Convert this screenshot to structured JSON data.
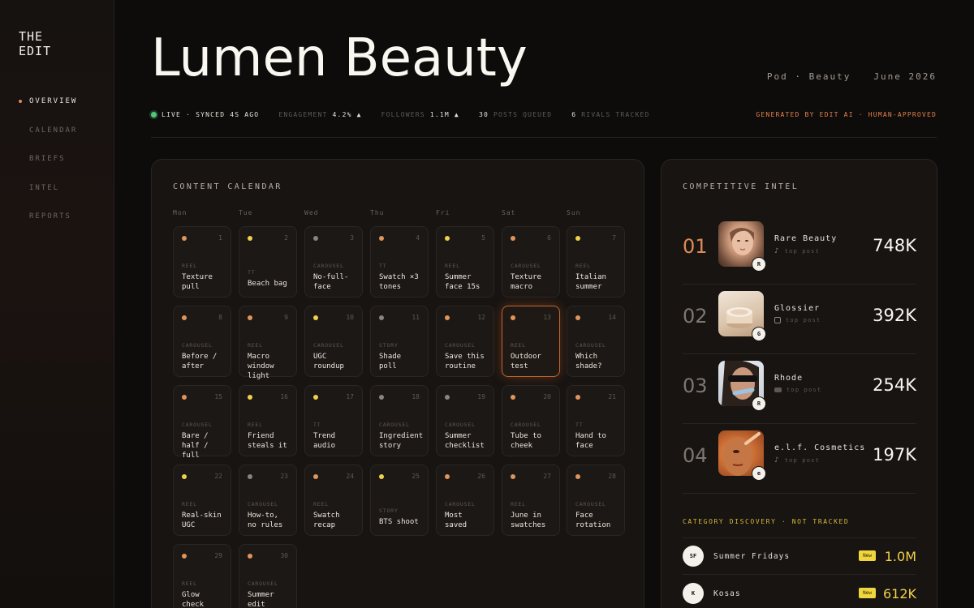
{
  "sidebar": {
    "logo": "THE\nEDIT",
    "items": [
      {
        "label": "OVERVIEW",
        "active": true
      },
      {
        "label": "CALENDAR",
        "active": false
      },
      {
        "label": "BRIEFS",
        "active": false
      },
      {
        "label": "INTEL",
        "active": false
      },
      {
        "label": "REPORTS",
        "active": false
      }
    ]
  },
  "header": {
    "title": "Lumen Beauty",
    "pod": "Pod · Beauty",
    "date": "June 2026",
    "status": {
      "live": "LIVE · SYNCED 4S AGO",
      "engagement_label": "ENGAGEMENT",
      "engagement_value": "4.2% ▲",
      "followers_label": "FOLLOWERS",
      "followers_value": "1.1M ▲",
      "posts_count": "30",
      "posts_label": "POSTS QUEUED",
      "rivals_count": "6",
      "rivals_label": "RIVALS TRACKED",
      "generated": "GENERATED BY EDIT AI · HUMAN-APPROVED"
    }
  },
  "calendar": {
    "title": "CONTENT CALENDAR",
    "days": [
      "Mon",
      "Tue",
      "Wed",
      "Thu",
      "Fri",
      "Sat",
      "Sun"
    ],
    "selected_day": 13,
    "cells": [
      {
        "num": "1",
        "kind": "REEL",
        "label": "Texture pull",
        "color": "#e0955a"
      },
      {
        "num": "2",
        "kind": "TT",
        "label": "Beach bag",
        "color": "#f0d24a"
      },
      {
        "num": "3",
        "kind": "CAROUSEL",
        "label": "No-full-face",
        "color": "#8b847e"
      },
      {
        "num": "4",
        "kind": "TT",
        "label": "Swatch ×3 tones",
        "color": "#e0955a"
      },
      {
        "num": "5",
        "kind": "REEL",
        "label": "Summer face 15s",
        "color": "#f0d24a"
      },
      {
        "num": "6",
        "kind": "CAROUSEL",
        "label": "Texture macro",
        "color": "#e0955a"
      },
      {
        "num": "7",
        "kind": "REEL",
        "label": "Italian summer",
        "color": "#f0d24a"
      },
      {
        "num": "8",
        "kind": "CAROUSEL",
        "label": "Before / after",
        "color": "#e0955a"
      },
      {
        "num": "9",
        "kind": "REEL",
        "label": "Macro window light",
        "color": "#e0955a"
      },
      {
        "num": "10",
        "kind": "CAROUSEL",
        "label": "UGC roundup",
        "color": "#f0d24a"
      },
      {
        "num": "11",
        "kind": "STORY",
        "label": "Shade poll",
        "color": "#8b847e"
      },
      {
        "num": "12",
        "kind": "CAROUSEL",
        "label": "Save this routine",
        "color": "#e0955a"
      },
      {
        "num": "13",
        "kind": "REEL",
        "label": "Outdoor test",
        "color": "#e0955a"
      },
      {
        "num": "14",
        "kind": "CAROUSEL",
        "label": "Which shade?",
        "color": "#e0955a"
      },
      {
        "num": "15",
        "kind": "CAROUSEL",
        "label": "Bare / half / full",
        "color": "#e0955a"
      },
      {
        "num": "16",
        "kind": "REEL",
        "label": "Friend steals it",
        "color": "#f0d24a"
      },
      {
        "num": "17",
        "kind": "TT",
        "label": "Trend audio",
        "color": "#f0d24a"
      },
      {
        "num": "18",
        "kind": "CAROUSEL",
        "label": "Ingredient story",
        "color": "#8b847e"
      },
      {
        "num": "19",
        "kind": "CAROUSEL",
        "label": "Summer checklist",
        "color": "#8b847e"
      },
      {
        "num": "20",
        "kind": "CAROUSEL",
        "label": "Tube to cheek",
        "color": "#e0955a"
      },
      {
        "num": "21",
        "kind": "TT",
        "label": "Hand to face",
        "color": "#e0955a"
      },
      {
        "num": "22",
        "kind": "REEL",
        "label": "Real-skin UGC",
        "color": "#f0d24a"
      },
      {
        "num": "23",
        "kind": "CAROUSEL",
        "label": "How-to, no rules",
        "color": "#8b847e"
      },
      {
        "num": "24",
        "kind": "REEL",
        "label": "Swatch recap",
        "color": "#e0955a"
      },
      {
        "num": "25",
        "kind": "STORY",
        "label": "BTS shoot",
        "color": "#f0d24a"
      },
      {
        "num": "26",
        "kind": "CAROUSEL",
        "label": "Most saved",
        "color": "#e0955a"
      },
      {
        "num": "27",
        "kind": "REEL",
        "label": "June in swatches",
        "color": "#e0955a"
      },
      {
        "num": "28",
        "kind": "CAROUSEL",
        "label": "Face rotation",
        "color": "#e0955a"
      },
      {
        "num": "29",
        "kind": "REEL",
        "label": "Glow check",
        "color": "#e0955a"
      },
      {
        "num": "30",
        "kind": "CAROUSEL",
        "label": "Summer edit",
        "color": "#e0955a"
      }
    ]
  },
  "intel": {
    "title": "COMPETITIVE INTEL",
    "rivals": [
      {
        "rank": "01",
        "name": "Rare Beauty",
        "badge": "R",
        "platform_icon": "tiktok-icon",
        "sub": "top post",
        "count": "748K"
      },
      {
        "rank": "02",
        "name": "Glossier",
        "badge": "G",
        "platform_icon": "instagram-icon",
        "sub": "top post",
        "count": "392K"
      },
      {
        "rank": "03",
        "name": "Rhode",
        "badge": "R",
        "platform_icon": "youtube-icon",
        "sub": "top post",
        "count": "254K"
      },
      {
        "rank": "04",
        "name": "e.l.f. Cosmetics",
        "badge": "e",
        "platform_icon": "tiktok-icon",
        "sub": "top post",
        "count": "197K"
      }
    ],
    "discovery_title": "CATEGORY DISCOVERY · NOT TRACKED",
    "discovery": [
      {
        "initials": "SF",
        "name": "Summer Fridays",
        "badge": "New",
        "count": "1.0M"
      },
      {
        "initials": "K",
        "name": "Kosas",
        "badge": "New",
        "count": "612K"
      }
    ]
  }
}
